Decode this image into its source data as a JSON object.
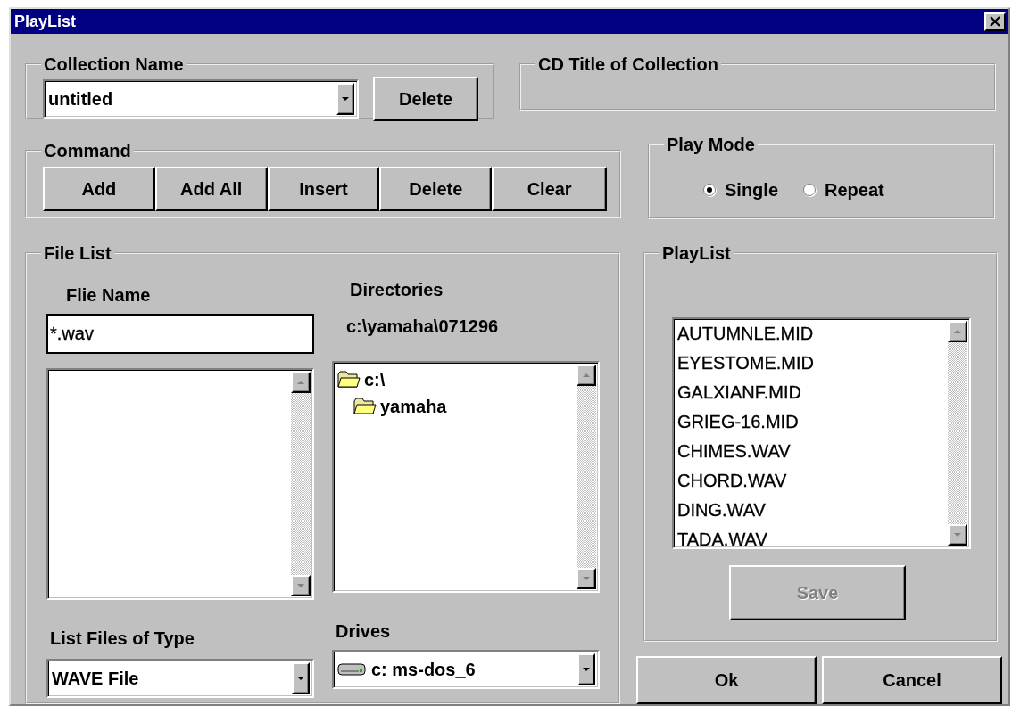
{
  "window": {
    "title": "PlayList"
  },
  "collection": {
    "label": "Collection Name",
    "value": "untitled",
    "button": "Delete"
  },
  "cd_title": {
    "label": "CD Title of Collection"
  },
  "command": {
    "label": "Command",
    "buttons": [
      "Add",
      "Add All",
      "Insert",
      "Delete",
      "Clear"
    ]
  },
  "play_mode": {
    "label": "Play Mode",
    "options": [
      {
        "label": "Single",
        "selected": true
      },
      {
        "label": "Repeat",
        "selected": false
      }
    ]
  },
  "file_list": {
    "label": "File List",
    "file_name": {
      "label": "Flie Name",
      "value": "*.wav"
    },
    "directories": {
      "label": "Directories",
      "path": "c:\\yamaha\\071296",
      "items": [
        {
          "label": "c:\\",
          "children": [
            {
              "label": "yamaha"
            }
          ]
        }
      ]
    },
    "file_type": {
      "label": "List Files of Type",
      "value": "WAVE File"
    },
    "drives": {
      "label": "Drives",
      "value": "c: ms-dos_6"
    }
  },
  "playlist": {
    "label": "PlayList",
    "items": [
      "AUTUMNLE.MID",
      "EYESTOME.MID",
      "GALXIANF.MID",
      "GRIEG-16.MID",
      "CHIMES.WAV",
      "CHORD.WAV",
      "DING.WAV",
      "TADA.WAV"
    ],
    "save": {
      "label": "Save",
      "disabled": true
    }
  },
  "buttons": [
    "Ok",
    "Cancel"
  ]
}
